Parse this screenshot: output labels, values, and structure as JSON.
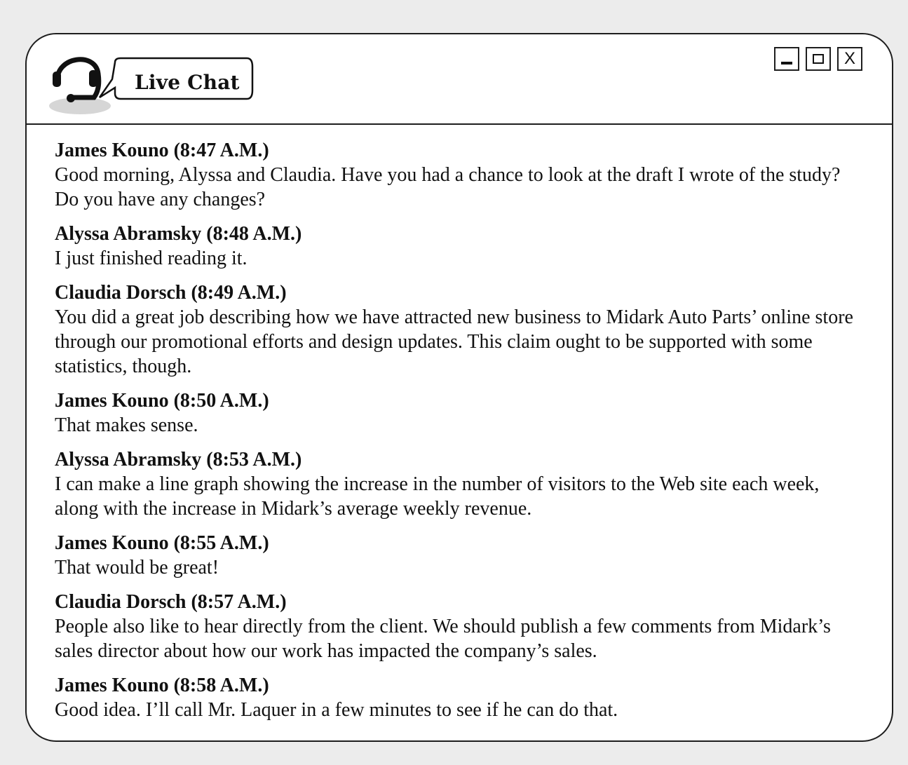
{
  "window": {
    "title": "Live Chat",
    "controls": {
      "close_label": "X"
    }
  },
  "messages": [
    {
      "sender": "James Kouno",
      "time": "(8:47 A.M.)",
      "text": "Good morning, Alyssa and Claudia. Have you had a chance to look at the draft I wrote of the study? Do you have any changes?"
    },
    {
      "sender": "Alyssa Abramsky",
      "time": "(8:48 A.M.)",
      "text": "I just finished reading it."
    },
    {
      "sender": "Claudia Dorsch",
      "time": "(8:49 A.M.)",
      "text": "You did a great job describing how we have attracted new business to Midark Auto Parts’ online store through our promotional efforts and design updates. This claim ought to be supported with some statistics, though."
    },
    {
      "sender": "James Kouno",
      "time": "(8:50 A.M.)",
      "text": "That makes sense."
    },
    {
      "sender": "Alyssa Abramsky",
      "time": "(8:53 A.M.)",
      "text": "I can make a line graph showing the increase in the number of visitors to the Web site each week, along with the increase in Midark’s average weekly revenue."
    },
    {
      "sender": "James Kouno",
      "time": "(8:55 A.M.)",
      "text": "That would be great!"
    },
    {
      "sender": "Claudia Dorsch",
      "time": "(8:57 A.M.)",
      "text": "People also like to hear directly from the client. We should publish a few comments from Midark’s sales director about how our work has impacted the company’s sales."
    },
    {
      "sender": "James Kouno",
      "time": "(8:58 A.M.)",
      "text": "Good idea. I’ll call Mr. Laquer in a few minutes to see if he can do that."
    }
  ]
}
